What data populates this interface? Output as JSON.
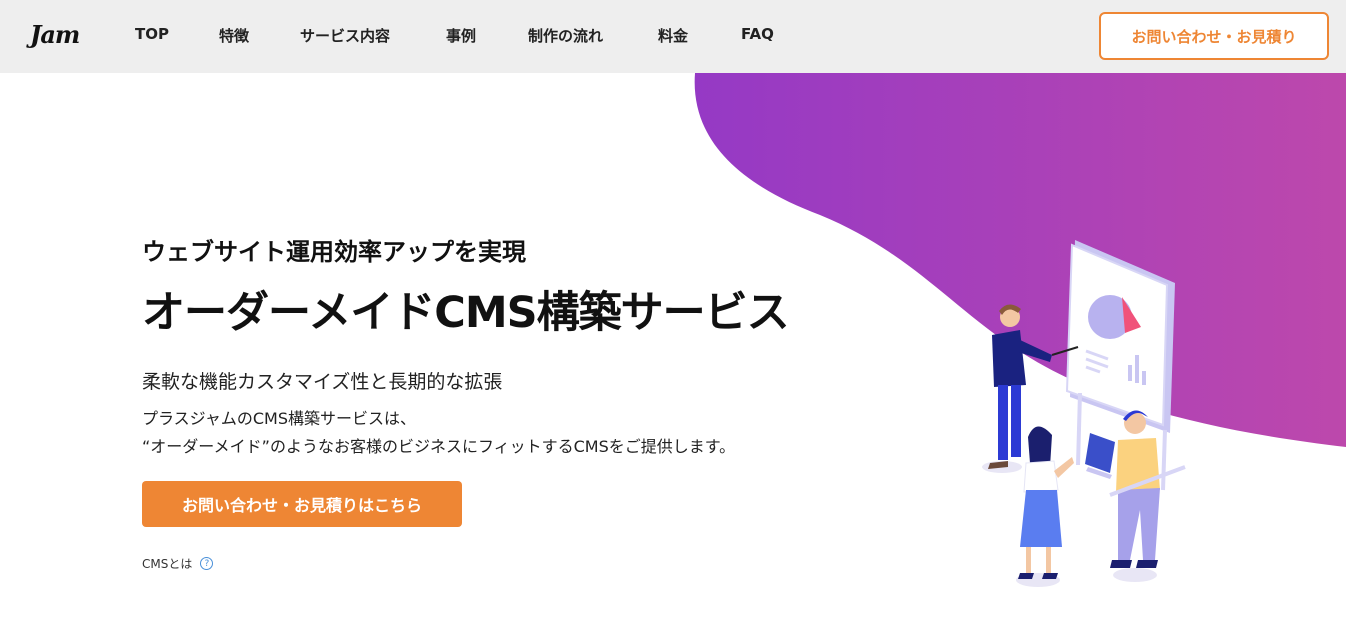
{
  "header": {
    "logo": "Jam",
    "nav": [
      {
        "label": "TOP"
      },
      {
        "label": "特徴"
      },
      {
        "label": "サービス内容"
      },
      {
        "label": "事例"
      },
      {
        "label": "制作の流れ"
      },
      {
        "label": "料金"
      },
      {
        "label": "FAQ"
      }
    ],
    "cta_label": "お問い合わせ・お見積り"
  },
  "hero": {
    "subhead": "ウェブサイト運用効率アップを実現",
    "headline": "オーダーメイドCMS構築サービス",
    "tagline": "柔軟な機能カスタマイズ性と長期的な拡張",
    "description_line1": "プラスジャムのCMS構築サービスは、",
    "description_line2": "“オーダーメイド”のようなお客様のビジネスにフィットするCMSをご提供します。",
    "cta_label": "お問い合わせ・お見積りはこちら",
    "cms_link_label": "CMSとは",
    "help_icon_glyph": "?"
  },
  "colors": {
    "accent": "#ee8634",
    "header_bg": "#eeeeee",
    "blob_start": "#9539c5",
    "blob_end": "#bd48ac"
  }
}
